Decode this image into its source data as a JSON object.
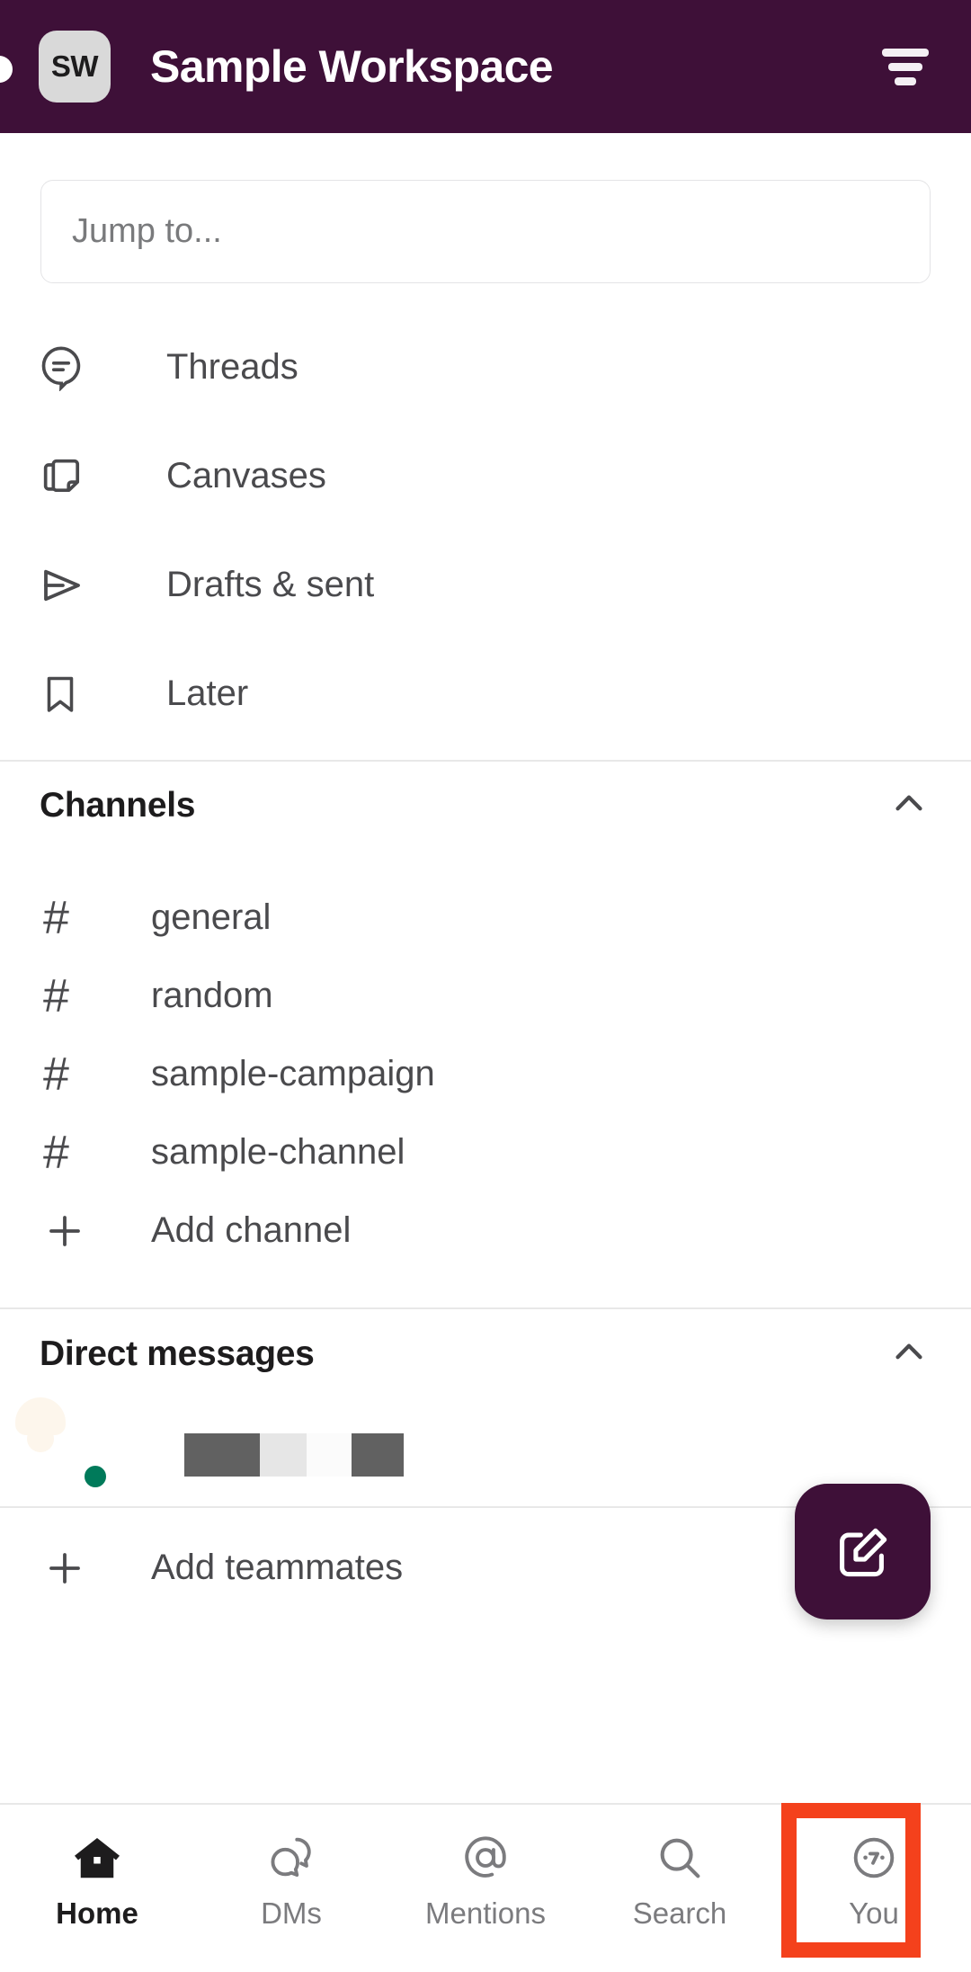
{
  "header": {
    "workspace_initials": "SW",
    "workspace_title": "Sample Workspace",
    "filter_icon": "filter-icon",
    "background_color": "#3E1038"
  },
  "search": {
    "placeholder": "Jump to...",
    "value": ""
  },
  "nav": {
    "items": [
      {
        "label": "Threads",
        "icon": "threads-icon"
      },
      {
        "label": "Canvases",
        "icon": "canvases-icon"
      },
      {
        "label": "Drafts & sent",
        "icon": "drafts-sent-icon"
      },
      {
        "label": "Later",
        "icon": "later-bookmark-icon"
      }
    ]
  },
  "channels": {
    "section_title": "Channels",
    "collapse_icon": "chevron-up-icon",
    "items": [
      {
        "prefix": "#",
        "name": "general"
      },
      {
        "prefix": "#",
        "name": "random"
      },
      {
        "prefix": "#",
        "name": "sample-campaign"
      },
      {
        "prefix": "#",
        "name": "sample-channel"
      }
    ],
    "add_label": "Add channel",
    "add_icon": "plus-icon"
  },
  "direct_messages": {
    "section_title": "Direct messages",
    "collapse_icon": "chevron-up-icon",
    "items": [
      {
        "name": "",
        "redacted": true,
        "presence": "online",
        "avatar_color": "#E8912D"
      }
    ],
    "add_label": "Add teammates",
    "add_icon": "plus-icon"
  },
  "compose": {
    "icon": "compose-pencil-icon",
    "color": "#3E1038"
  },
  "bottom_nav": {
    "active": "Home",
    "highlight_color": "#F4411C",
    "highlighted_tab": "You",
    "tabs": [
      {
        "label": "Home",
        "icon": "home-icon",
        "active": true
      },
      {
        "label": "DMs",
        "icon": "dms-icon",
        "active": false
      },
      {
        "label": "Mentions",
        "icon": "at-mention-icon",
        "active": false
      },
      {
        "label": "Search",
        "icon": "search-icon",
        "active": false
      },
      {
        "label": "You",
        "icon": "you-face-icon",
        "active": false
      }
    ]
  }
}
